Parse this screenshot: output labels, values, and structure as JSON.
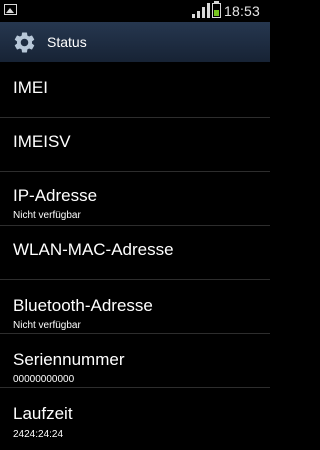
{
  "status_bar": {
    "time": "18:53",
    "left_icon": "image-icon",
    "signal_icon": "signal-icon",
    "battery_icon": "battery-icon",
    "battery_level": 0.5,
    "battery_color": "#78c51f"
  },
  "header": {
    "icon": "gear-icon",
    "title": "Status"
  },
  "items": [
    {
      "label": "IMEI",
      "value": ""
    },
    {
      "label": "IMEISV",
      "value": ""
    },
    {
      "label": "IP-Adresse",
      "value": "Nicht verfügbar"
    },
    {
      "label": "WLAN-MAC-Adresse",
      "value": ""
    },
    {
      "label": "Bluetooth-Adresse",
      "value": "Nicht verfügbar"
    },
    {
      "label": "Seriennummer",
      "value": "00000000000"
    },
    {
      "label": "Laufzeit",
      "value": "2424:24:24"
    }
  ]
}
